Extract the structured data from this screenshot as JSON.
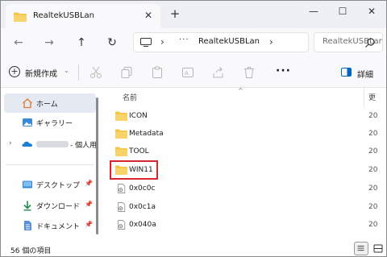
{
  "titlebar": {
    "tab_title": "RealtekUSBLan",
    "close_tab": "✕",
    "new_tab": "+",
    "minimize": "—",
    "maximize": "☐",
    "close": "✕"
  },
  "address": {
    "back": "←",
    "forward": "→",
    "up": "↑",
    "refresh": "↻",
    "dots": "···",
    "chevron": "›",
    "path": "RealtekUSBLan",
    "search_placeholder": "RealtekUSBLan"
  },
  "commands": {
    "new_label": "新規作成",
    "caret": "⌄",
    "more": "···",
    "details_label": "詳細"
  },
  "nav": {
    "items": [
      {
        "label": "ホーム",
        "icon": "home-icon",
        "selected": true
      },
      {
        "label": "ギャラリー",
        "icon": "gallery-icon"
      },
      {
        "label": "- 個人用",
        "icon": "onedrive-icon"
      },
      {
        "label": "デスクトップ",
        "icon": "desktop-icon",
        "pinned": true
      },
      {
        "label": "ダウンロード",
        "icon": "download-icon",
        "pinned": true
      },
      {
        "label": "ドキュメント",
        "icon": "documents-icon",
        "pinned": true
      }
    ],
    "pin": "📌"
  },
  "files": {
    "col_name": "名前",
    "col_date": "更",
    "sort_caret": "^",
    "rows": [
      {
        "name": "ICON",
        "type": "folder",
        "date": "20"
      },
      {
        "name": "Metadata",
        "type": "folder",
        "date": "20"
      },
      {
        "name": "TOOL",
        "type": "folder",
        "date": "20"
      },
      {
        "name": "WIN11",
        "type": "folder",
        "date": "20"
      },
      {
        "name": "0x0c0c",
        "type": "settings-file",
        "date": "20"
      },
      {
        "name": "0x0c1a",
        "type": "settings-file",
        "date": "20"
      },
      {
        "name": "0x040a",
        "type": "settings-file",
        "date": "20"
      }
    ]
  },
  "status": {
    "text": "56 個の項目"
  },
  "colors": {
    "folder": "#f4c542",
    "highlight": "#d9262c",
    "accent": "#0067c0",
    "selected": "#e5eaf2"
  }
}
